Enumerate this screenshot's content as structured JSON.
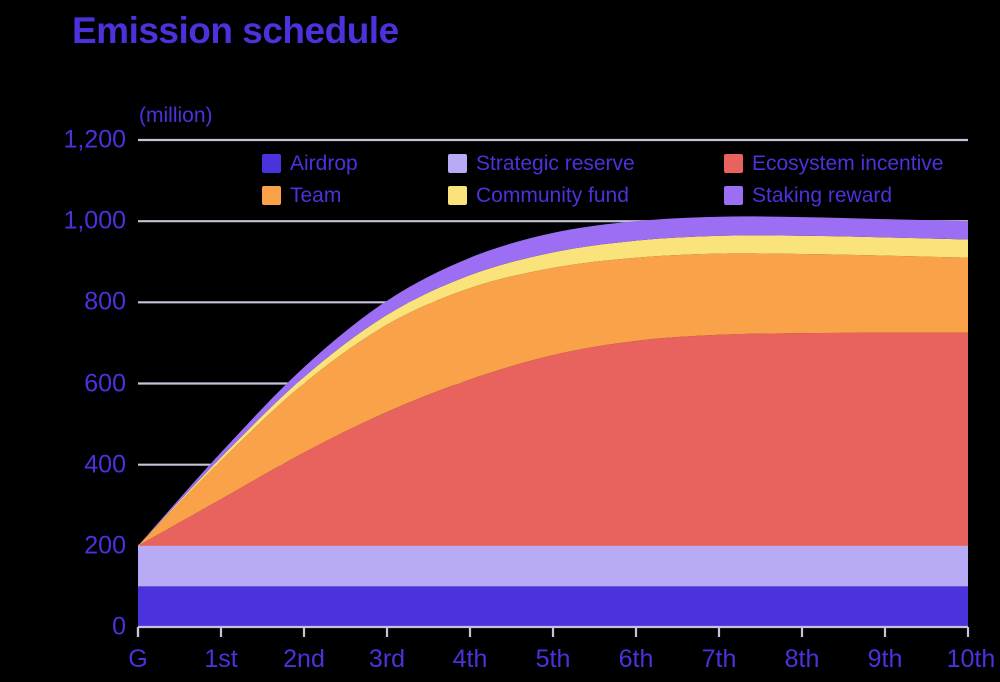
{
  "title": "Emission schedule",
  "unit_label": "(million)",
  "colors": {
    "background": "#000000",
    "text": "#4a32dc",
    "gridline": "#c3c3da",
    "airdrop": "#4a32dc",
    "strategic_reserve": "#b9aaf5",
    "ecosystem_incentive": "#e8635e",
    "team": "#f9a24a",
    "community_fund": "#f9e37a",
    "staking_reward": "#9b6ef3"
  },
  "legend": {
    "items": [
      {
        "label": "Airdrop",
        "color_key": "airdrop"
      },
      {
        "label": "Strategic reserve",
        "color_key": "strategic_reserve"
      },
      {
        "label": "Ecosystem incentive",
        "color_key": "ecosystem_incentive"
      },
      {
        "label": "Team",
        "color_key": "team"
      },
      {
        "label": "Community fund",
        "color_key": "community_fund"
      },
      {
        "label": "Staking reward",
        "color_key": "staking_reward"
      }
    ]
  },
  "chart_data": {
    "type": "area",
    "stacked": true,
    "title": "Emission schedule",
    "subtitle": "",
    "xlabel": "",
    "ylabel": "(million)",
    "categories": [
      "G",
      "1st",
      "2nd",
      "3rd",
      "4th",
      "5th",
      "6th",
      "7th",
      "8th",
      "9th",
      "10th"
    ],
    "x_tick_labels": [
      "G",
      "1st",
      "2nd",
      "3rd",
      "4th",
      "5th",
      "6th",
      "7th",
      "8th",
      "9th",
      "10th"
    ],
    "y_tick_labels": [
      "0",
      "200",
      "400",
      "600",
      "800",
      "1,000",
      "1,200"
    ],
    "y_ticks": [
      0,
      200,
      400,
      600,
      800,
      1000,
      1200
    ],
    "ylim": [
      0,
      1200
    ],
    "grid": true,
    "grid_axis": "y",
    "legend_position": "top-inside",
    "series": [
      {
        "name": "Airdrop",
        "color_key": "airdrop",
        "values": [
          100,
          100,
          100,
          100,
          100,
          100,
          100,
          100,
          100,
          100,
          100
        ]
      },
      {
        "name": "Strategic reserve",
        "color_key": "strategic_reserve",
        "values": [
          100,
          100,
          100,
          100,
          100,
          100,
          100,
          100,
          100,
          100,
          100
        ]
      },
      {
        "name": "Ecosystem incentive",
        "color_key": "ecosystem_incentive",
        "values": [
          0,
          115,
          230,
          330,
          410,
          470,
          505,
          520,
          524,
          525,
          525
        ]
      },
      {
        "name": "Team",
        "color_key": "team",
        "values": [
          0,
          95,
          170,
          215,
          225,
          215,
          205,
          200,
          195,
          190,
          185
        ]
      },
      {
        "name": "Community fund",
        "color_key": "community_fund",
        "values": [
          0,
          8,
          16,
          24,
          32,
          38,
          42,
          44,
          45,
          45,
          45
        ]
      },
      {
        "name": "Staking reward",
        "color_key": "staking_reward",
        "values": [
          0,
          12,
          24,
          35,
          43,
          48,
          48,
          47,
          46,
          45,
          45
        ]
      }
    ],
    "totals": [
      200,
      430,
      640,
      804,
      910,
      971,
      1000,
      1011,
      1010,
      1005,
      1000
    ]
  }
}
